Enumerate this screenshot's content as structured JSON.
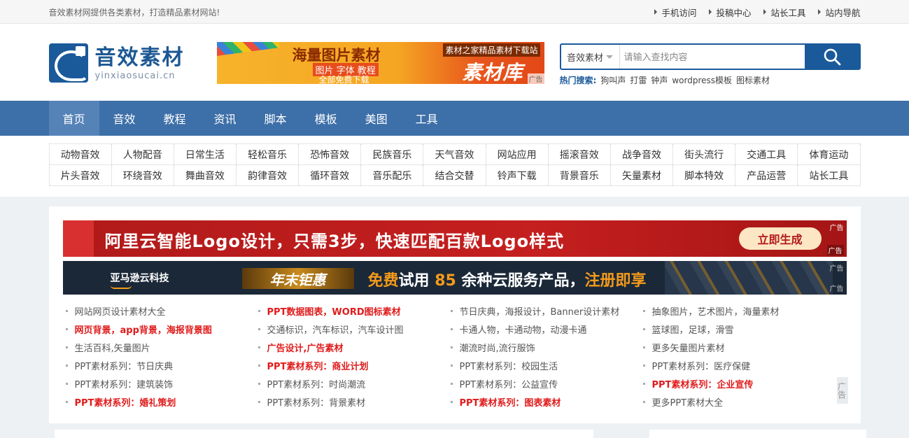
{
  "topbar": {
    "notice": "音效素材网提供各类素材，打造精品素材网站!",
    "links": [
      "手机访问",
      "投稿中心",
      "站长工具",
      "站内导航"
    ]
  },
  "logo": {
    "cn": "音效素材",
    "en": "yinxiaosucai.cn"
  },
  "top_banner": {
    "headline": "海量图片素材",
    "sub1": "图片 字体 教程",
    "sub2": "全部免费下载",
    "tag": "素材之家精品素材下载站",
    "brand": "素材库",
    "ad": "广告"
  },
  "search": {
    "category": "音效素材",
    "placeholder": "请输入查找内容",
    "hot_label": "热门搜索:",
    "hot": [
      "狗叫声",
      "打雷",
      "钟声",
      "wordpress模板",
      "图标素材"
    ]
  },
  "nav": [
    "首页",
    "音效",
    "教程",
    "资讯",
    "脚本",
    "模板",
    "美图",
    "工具"
  ],
  "subnav": [
    "动物音效",
    "人物配音",
    "日常生活",
    "轻松音乐",
    "恐怖音效",
    "民族音乐",
    "天气音效",
    "网站应用",
    "摇滚音效",
    "战争音效",
    "街头流行",
    "交通工具",
    "体育运动",
    "片头音效",
    "环绕音效",
    "舞曲音效",
    "韵律音效",
    "循环音效",
    "音乐配乐",
    "结合交替",
    "铃声下载",
    "背景音乐",
    "矢量素材",
    "脚本特效",
    "产品运营",
    "站长工具"
  ],
  "ad1": {
    "text": "阿里云智能Logo设计，只需3步，快速匹配百款Logo样式",
    "cta": "立即生成",
    "ad": "广告"
  },
  "ad2": {
    "brand": "亚马逊云科技",
    "pill": "年末钜惠",
    "t1": "免费",
    "t2": "试用 ",
    "t3": "85",
    "t4": " 余种云服务产品，",
    "t5": "注册即享",
    "ad": "广告"
  },
  "links": [
    {
      "text": "网站网页设计素材大全",
      "red": false
    },
    {
      "text": "PPT数据图表，WORD图标素材",
      "red": true
    },
    {
      "text": "节日庆典，海报设计，Banner设计素材",
      "red": false
    },
    {
      "text": "抽象图片，艺术图片，海量素材",
      "red": false
    },
    {
      "text": "网页背景，app背景，海报背景图",
      "red": true
    },
    {
      "text": "交通标识，汽车标识，汽车设计图",
      "red": false
    },
    {
      "text": "卡通人物，卡通动物，动漫卡通",
      "red": false
    },
    {
      "text": "篮球图，足球，滑雪",
      "red": false
    },
    {
      "text": "生活百科,矢量图片",
      "red": false
    },
    {
      "text": "广告设计,广告素材",
      "red": true
    },
    {
      "text": "潮流时尚,流行服饰",
      "red": false
    },
    {
      "text": "更多矢量图片素材",
      "red": false
    },
    {
      "text": "PPT素材系列：节日庆典",
      "red": false
    },
    {
      "text": "PPT素材系列：商业计划",
      "red": true
    },
    {
      "text": "PPT素材系列：校园生活",
      "red": false
    },
    {
      "text": "PPT素材系列：医疗保健",
      "red": false
    },
    {
      "text": "PPT素材系列：建筑装饰",
      "red": false
    },
    {
      "text": "PPT素材系列：时尚潮流",
      "red": false
    },
    {
      "text": "PPT素材系列：公益宣传",
      "red": false
    },
    {
      "text": "PPT素材系列：企业宣传",
      "red": true
    },
    {
      "text": "PPT素材系列：婚礼策划",
      "red": true
    },
    {
      "text": "PPT素材系列：背景素材",
      "red": false
    },
    {
      "text": "PPT素材系列：图表素材",
      "red": true
    },
    {
      "text": "更多PPT素材大全",
      "red": false
    }
  ],
  "side_ad": "广告",
  "colors": {
    "brand_blue": "#1a5a9a",
    "nav_bg": "#3d6fa8",
    "link_red": "#e01b1b"
  },
  "icons": {
    "search": "search-icon"
  }
}
